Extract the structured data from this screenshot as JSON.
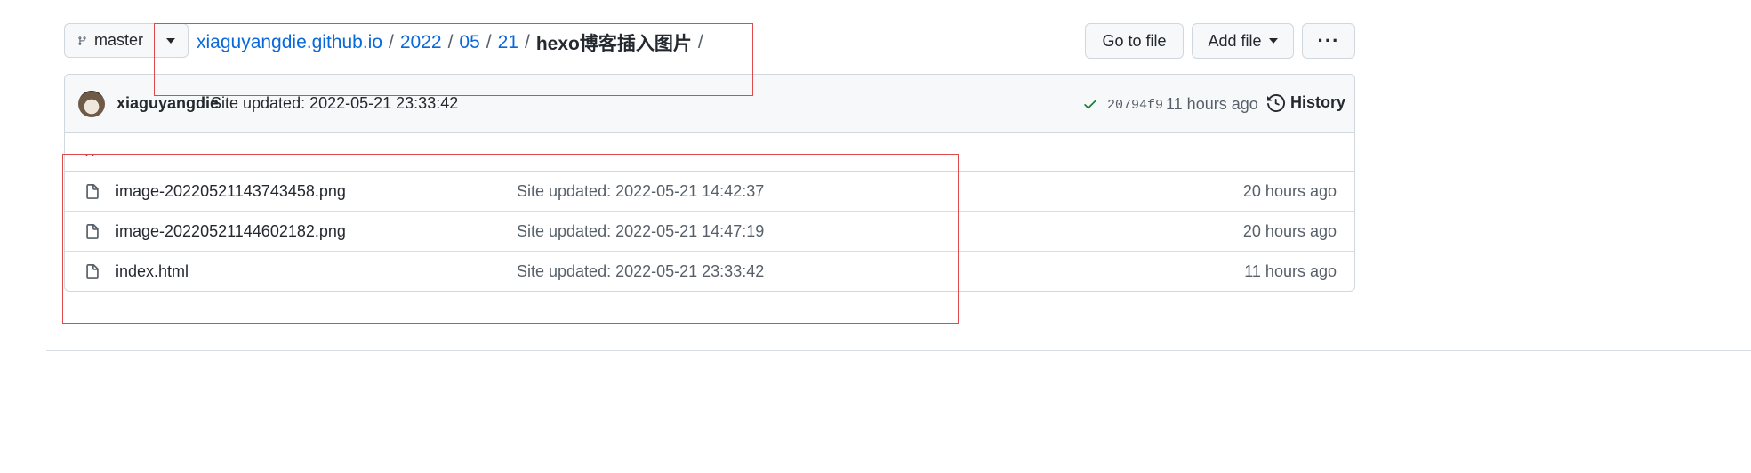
{
  "toolbar": {
    "branch": "master",
    "go_to_file": "Go to file",
    "add_file": "Add file",
    "more": "···"
  },
  "breadcrumb": {
    "repo": "xiaguyangdie.github.io",
    "sep": "/",
    "year": "2022",
    "month": "05",
    "day": "21",
    "current": "hexo博客插入图片"
  },
  "commit": {
    "author": "xiaguyangdie",
    "message": "Site updated: 2022-05-21 23:33:42",
    "sha": "20794f9",
    "age": "11 hours ago",
    "history": "History",
    "status_color": "#1a7f37"
  },
  "parent": "..",
  "files": [
    {
      "name": "image-20220521143743458.png",
      "message": "Site updated: 2022-05-21 14:42:37",
      "age": "20 hours ago"
    },
    {
      "name": "image-20220521144602182.png",
      "message": "Site updated: 2022-05-21 14:47:19",
      "age": "20 hours ago"
    },
    {
      "name": "index.html",
      "message": "Site updated: 2022-05-21 23:33:42",
      "age": "11 hours ago"
    }
  ],
  "colors": {
    "link": "#0969da",
    "highlight": "#e04a4a"
  }
}
